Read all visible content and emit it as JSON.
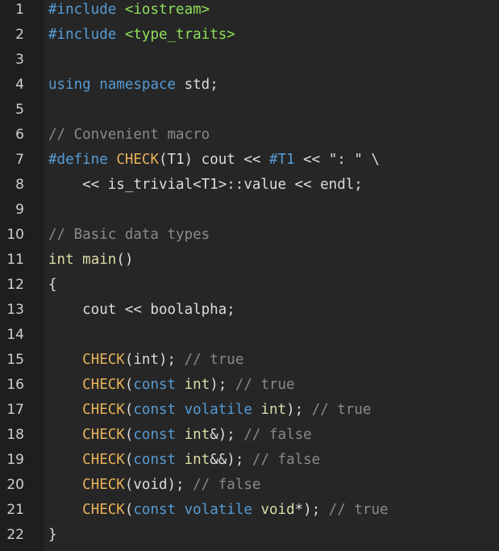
{
  "editor": {
    "lines": [
      {
        "n": "1",
        "tokens": [
          {
            "t": "#include",
            "c": "pp"
          },
          {
            "t": " ",
            "c": "txt"
          },
          {
            "t": "<iostream>",
            "c": "str"
          }
        ]
      },
      {
        "n": "2",
        "tokens": [
          {
            "t": "#include",
            "c": "pp"
          },
          {
            "t": " ",
            "c": "txt"
          },
          {
            "t": "<type_traits>",
            "c": "str"
          }
        ]
      },
      {
        "n": "3",
        "tokens": []
      },
      {
        "n": "4",
        "tokens": [
          {
            "t": "using",
            "c": "kw"
          },
          {
            "t": " ",
            "c": "txt"
          },
          {
            "t": "namespace",
            "c": "kw"
          },
          {
            "t": " std;",
            "c": "txt"
          }
        ]
      },
      {
        "n": "5",
        "tokens": []
      },
      {
        "n": "6",
        "tokens": [
          {
            "t": "// Convenient macro",
            "c": "cm"
          }
        ]
      },
      {
        "n": "7",
        "tokens": [
          {
            "t": "#define",
            "c": "pp"
          },
          {
            "t": " ",
            "c": "txt"
          },
          {
            "t": "CHECK",
            "c": "mac"
          },
          {
            "t": "(T1) cout << ",
            "c": "txt"
          },
          {
            "t": "#T1",
            "c": "pp"
          },
          {
            "t": " << \": \" \\",
            "c": "txt"
          }
        ]
      },
      {
        "n": "8",
        "tokens": [
          {
            "t": "    << is_trivial<T1>::value << endl;",
            "c": "txt"
          }
        ]
      },
      {
        "n": "9",
        "tokens": []
      },
      {
        "n": "10",
        "tokens": [
          {
            "t": "// Basic data types",
            "c": "cm"
          }
        ]
      },
      {
        "n": "11",
        "tokens": [
          {
            "t": "int",
            "c": "ty"
          },
          {
            "t": " ",
            "c": "txt"
          },
          {
            "t": "main",
            "c": "fn"
          },
          {
            "t": "()",
            "c": "txt"
          }
        ]
      },
      {
        "n": "12",
        "tokens": [
          {
            "t": "{",
            "c": "txt"
          }
        ]
      },
      {
        "n": "13",
        "tokens": [
          {
            "t": "    cout << boolalpha;",
            "c": "txt"
          }
        ]
      },
      {
        "n": "14",
        "tokens": []
      },
      {
        "n": "15",
        "tokens": [
          {
            "t": "    ",
            "c": "txt"
          },
          {
            "t": "CHECK",
            "c": "mac"
          },
          {
            "t": "(int); ",
            "c": "txt"
          },
          {
            "t": "// true",
            "c": "cm"
          }
        ]
      },
      {
        "n": "16",
        "tokens": [
          {
            "t": "    ",
            "c": "txt"
          },
          {
            "t": "CHECK",
            "c": "mac"
          },
          {
            "t": "(",
            "c": "txt"
          },
          {
            "t": "const",
            "c": "kw"
          },
          {
            "t": " ",
            "c": "txt"
          },
          {
            "t": "int",
            "c": "ty"
          },
          {
            "t": "); ",
            "c": "txt"
          },
          {
            "t": "// true",
            "c": "cm"
          }
        ]
      },
      {
        "n": "17",
        "tokens": [
          {
            "t": "    ",
            "c": "txt"
          },
          {
            "t": "CHECK",
            "c": "mac"
          },
          {
            "t": "(",
            "c": "txt"
          },
          {
            "t": "const",
            "c": "kw"
          },
          {
            "t": " ",
            "c": "txt"
          },
          {
            "t": "volatile",
            "c": "kw"
          },
          {
            "t": " ",
            "c": "txt"
          },
          {
            "t": "int",
            "c": "ty"
          },
          {
            "t": "); ",
            "c": "txt"
          },
          {
            "t": "// true",
            "c": "cm"
          }
        ]
      },
      {
        "n": "18",
        "tokens": [
          {
            "t": "    ",
            "c": "txt"
          },
          {
            "t": "CHECK",
            "c": "mac"
          },
          {
            "t": "(",
            "c": "txt"
          },
          {
            "t": "const",
            "c": "kw"
          },
          {
            "t": " ",
            "c": "txt"
          },
          {
            "t": "int",
            "c": "ty"
          },
          {
            "t": "&); ",
            "c": "txt"
          },
          {
            "t": "// false",
            "c": "cm"
          }
        ]
      },
      {
        "n": "19",
        "tokens": [
          {
            "t": "    ",
            "c": "txt"
          },
          {
            "t": "CHECK",
            "c": "mac"
          },
          {
            "t": "(",
            "c": "txt"
          },
          {
            "t": "const",
            "c": "kw"
          },
          {
            "t": " ",
            "c": "txt"
          },
          {
            "t": "int",
            "c": "ty"
          },
          {
            "t": "&&); ",
            "c": "txt"
          },
          {
            "t": "// false",
            "c": "cm"
          }
        ]
      },
      {
        "n": "20",
        "tokens": [
          {
            "t": "    ",
            "c": "txt"
          },
          {
            "t": "CHECK",
            "c": "mac"
          },
          {
            "t": "(void); ",
            "c": "txt"
          },
          {
            "t": "// false",
            "c": "cm"
          }
        ]
      },
      {
        "n": "21",
        "tokens": [
          {
            "t": "    ",
            "c": "txt"
          },
          {
            "t": "CHECK",
            "c": "mac"
          },
          {
            "t": "(",
            "c": "txt"
          },
          {
            "t": "const",
            "c": "kw"
          },
          {
            "t": " ",
            "c": "txt"
          },
          {
            "t": "volatile",
            "c": "kw"
          },
          {
            "t": " ",
            "c": "txt"
          },
          {
            "t": "void",
            "c": "ty"
          },
          {
            "t": "*); ",
            "c": "txt"
          },
          {
            "t": "// true",
            "c": "cm"
          }
        ]
      },
      {
        "n": "22",
        "tokens": [
          {
            "t": "}",
            "c": "txt"
          }
        ]
      }
    ]
  }
}
